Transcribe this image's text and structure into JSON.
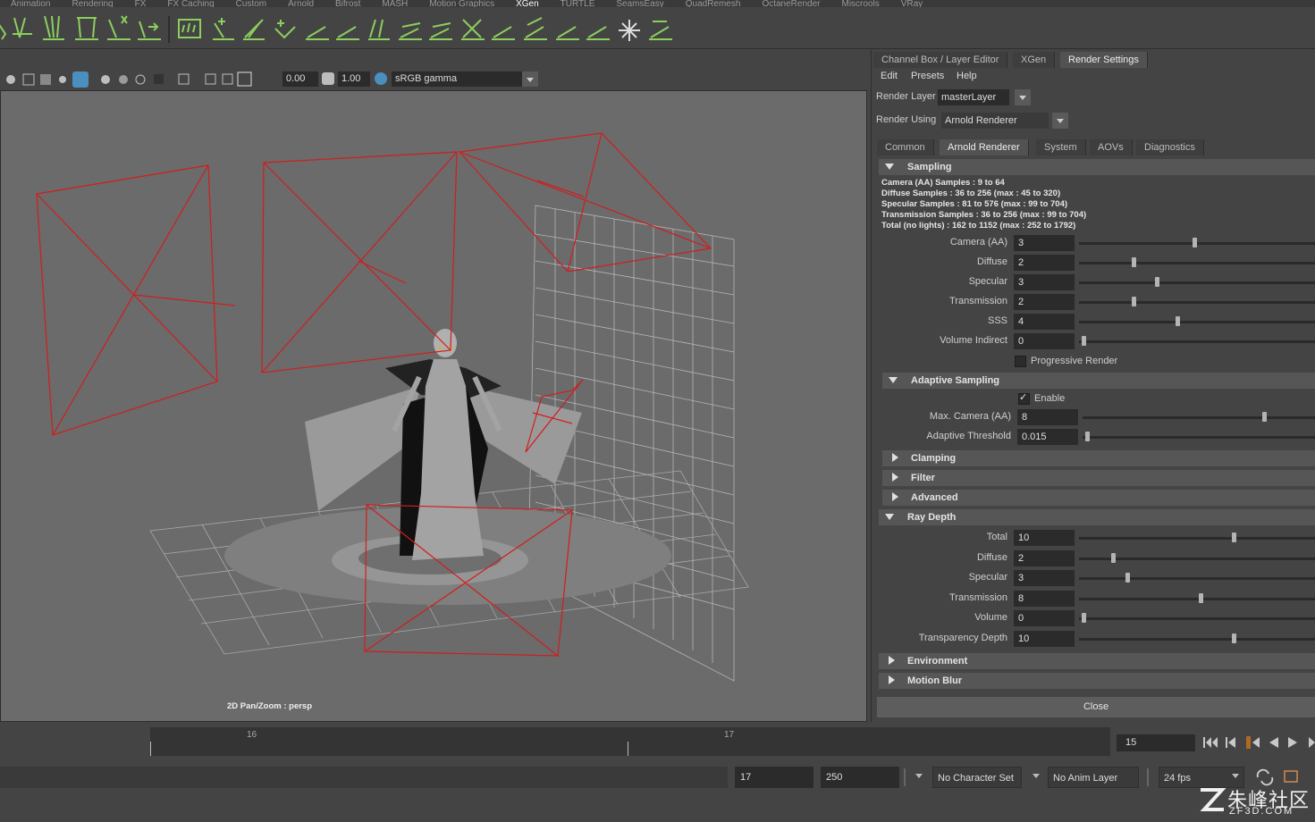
{
  "shelf": {
    "tabs": [
      "Animation",
      "Rendering",
      "FX",
      "FX Caching",
      "Custom",
      "Arnold",
      "Bifrost",
      "MASH",
      "Motion Graphics",
      "XGen",
      "TURTLE",
      "SeamsEasy",
      "QuadRemesh",
      "OctaneRender",
      "Miscrools",
      "VRay"
    ],
    "active_tab": "XGen"
  },
  "viewport_toolbar": {
    "exposure": "0.00",
    "gamma": "1.00",
    "colorspace": "sRGB gamma"
  },
  "viewport": {
    "caption": "2D Pan/Zoom : persp"
  },
  "panel": {
    "tabs": [
      "Channel Box / Layer Editor",
      "XGen",
      "Render Settings"
    ],
    "active_tab": "Render Settings",
    "menu": [
      "Edit",
      "Presets",
      "Help"
    ],
    "render_layer_label": "Render Layer",
    "render_layer_value": "masterLayer",
    "render_using_label": "Render Using",
    "render_using_value": "Arnold Renderer",
    "sub_tabs": [
      "Common",
      "Arnold Renderer",
      "System",
      "AOVs",
      "Diagnostics"
    ],
    "active_sub_tab": "Arnold Renderer",
    "sampling": {
      "title": "Sampling",
      "info": [
        "Camera (AA) Samples : 9 to 64",
        "Diffuse Samples : 36 to 256 (max : 45 to 320)",
        "Specular Samples : 81 to 576 (max : 99 to 704)",
        "Transmission Samples : 36 to 256 (max : 99 to 704)",
        "Total (no lights) : 162 to 1152 (max : 252 to 1792)"
      ],
      "rows": [
        {
          "label": "Camera (AA)",
          "value": "3",
          "fraction": 0.53
        },
        {
          "label": "Diffuse",
          "value": "2",
          "fraction": 0.24
        },
        {
          "label": "Specular",
          "value": "3",
          "fraction": 0.35
        },
        {
          "label": "Transmission",
          "value": "2",
          "fraction": 0.24
        },
        {
          "label": "SSS",
          "value": "4",
          "fraction": 0.45
        },
        {
          "label": "Volume Indirect",
          "value": "0",
          "fraction": 0.0
        }
      ],
      "progressive_render_label": "Progressive Render"
    },
    "adaptive": {
      "title": "Adaptive Sampling",
      "enable_label": "Enable",
      "rows": [
        {
          "label": "Max. Camera (AA)",
          "value": "8",
          "fraction": 0.86
        },
        {
          "label": "Adaptive Threshold",
          "value": "0.015",
          "fraction": 0.0
        }
      ]
    },
    "collapsed_sections_1": [
      "Clamping",
      "Filter",
      "Advanced"
    ],
    "ray_depth": {
      "title": "Ray Depth",
      "rows": [
        {
          "label": "Total",
          "value": "10",
          "fraction": 0.72
        },
        {
          "label": "Diffuse",
          "value": "2",
          "fraction": 0.14
        },
        {
          "label": "Specular",
          "value": "3",
          "fraction": 0.21
        },
        {
          "label": "Transmission",
          "value": "8",
          "fraction": 0.56
        },
        {
          "label": "Volume",
          "value": "0",
          "fraction": 0.0
        },
        {
          "label": "Transparency Depth",
          "value": "10",
          "fraction": 0.72
        }
      ]
    },
    "collapsed_sections_2": [
      "Environment",
      "Motion Blur"
    ],
    "close_label": "Close"
  },
  "timeline": {
    "tick_16": "16",
    "tick_17": "17",
    "current_frame": "15"
  },
  "range": {
    "start": "17",
    "end": "250",
    "character_set": "No Character Set",
    "anim_layer": "No Anim Layer",
    "fps": "24 fps"
  },
  "watermark": {
    "cn": "朱峰社区",
    "url": "ZF3D.COM"
  },
  "colors": {
    "accent_green": "#6fbf4a",
    "camera_red": "#cc2222",
    "viewport_bg": "#6b6b6b",
    "panel_bg": "#444444"
  }
}
